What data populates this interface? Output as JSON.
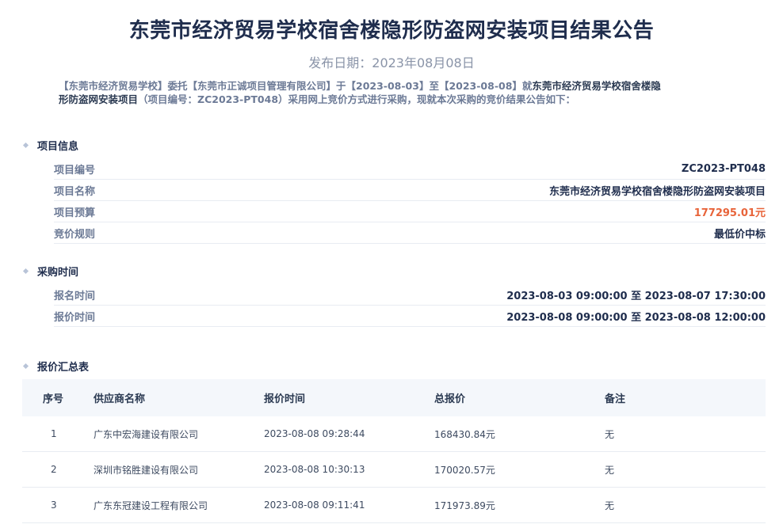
{
  "title": "东莞市经济贸易学校宿舍楼隐形防盗网安装项目结果公告",
  "publish_date": "发布日期：2023年08月08日",
  "intro": {
    "part1": "【东莞市经济贸易学校】委托【东莞市正诚项目管理有限公司】于【2023-08-03】至【2023-08-08】就",
    "project_name_line1": "东莞市经济贸易学校宿舍楼隐",
    "project_name_line2": "形防盗网安装项目",
    "part2": "（项目编号：ZC2023-PT048）采用网上竞价方式进行采购，现就本次采购的竞价结果公告如下："
  },
  "project_info": {
    "section_title": "项目信息",
    "rows": [
      {
        "label": "项目编号",
        "value": "ZC2023-PT048"
      },
      {
        "label": "项目名称",
        "value": "东莞市经济贸易学校宿舍楼隐形防盗网安装项目"
      },
      {
        "label": "项目预算",
        "value": "177295.01元"
      },
      {
        "label": "竞价规则",
        "value": "最低价中标"
      }
    ]
  },
  "procurement_time": {
    "section_title": "采购时间",
    "rows": [
      {
        "label": "报名时间",
        "value": "2023-08-03 09:00:00 至 2023-08-07 17:30:00"
      },
      {
        "label": "报价时间",
        "value": "2023-08-08 09:00:00 至 2023-08-08 12:00:00"
      }
    ]
  },
  "bid_summary": {
    "section_title": "报价汇总表",
    "headers": [
      "序号",
      "供应商名称",
      "报价时间",
      "总报价",
      "备注"
    ],
    "rows": [
      [
        "1",
        "广东中宏海建设有限公司",
        "2023-08-08 09:28:44",
        "168430.84元",
        "无"
      ],
      [
        "2",
        "深圳市铭胜建设有限公司",
        "2023-08-08 10:30:13",
        "170020.57元",
        "无"
      ],
      [
        "3",
        "广东东冠建设工程有限公司",
        "2023-08-08 09:11:41",
        "171973.89元",
        "无"
      ]
    ]
  },
  "colors": {
    "price": "#e8643a",
    "title": "#1f2d4d",
    "muted": "#6c7a96"
  }
}
